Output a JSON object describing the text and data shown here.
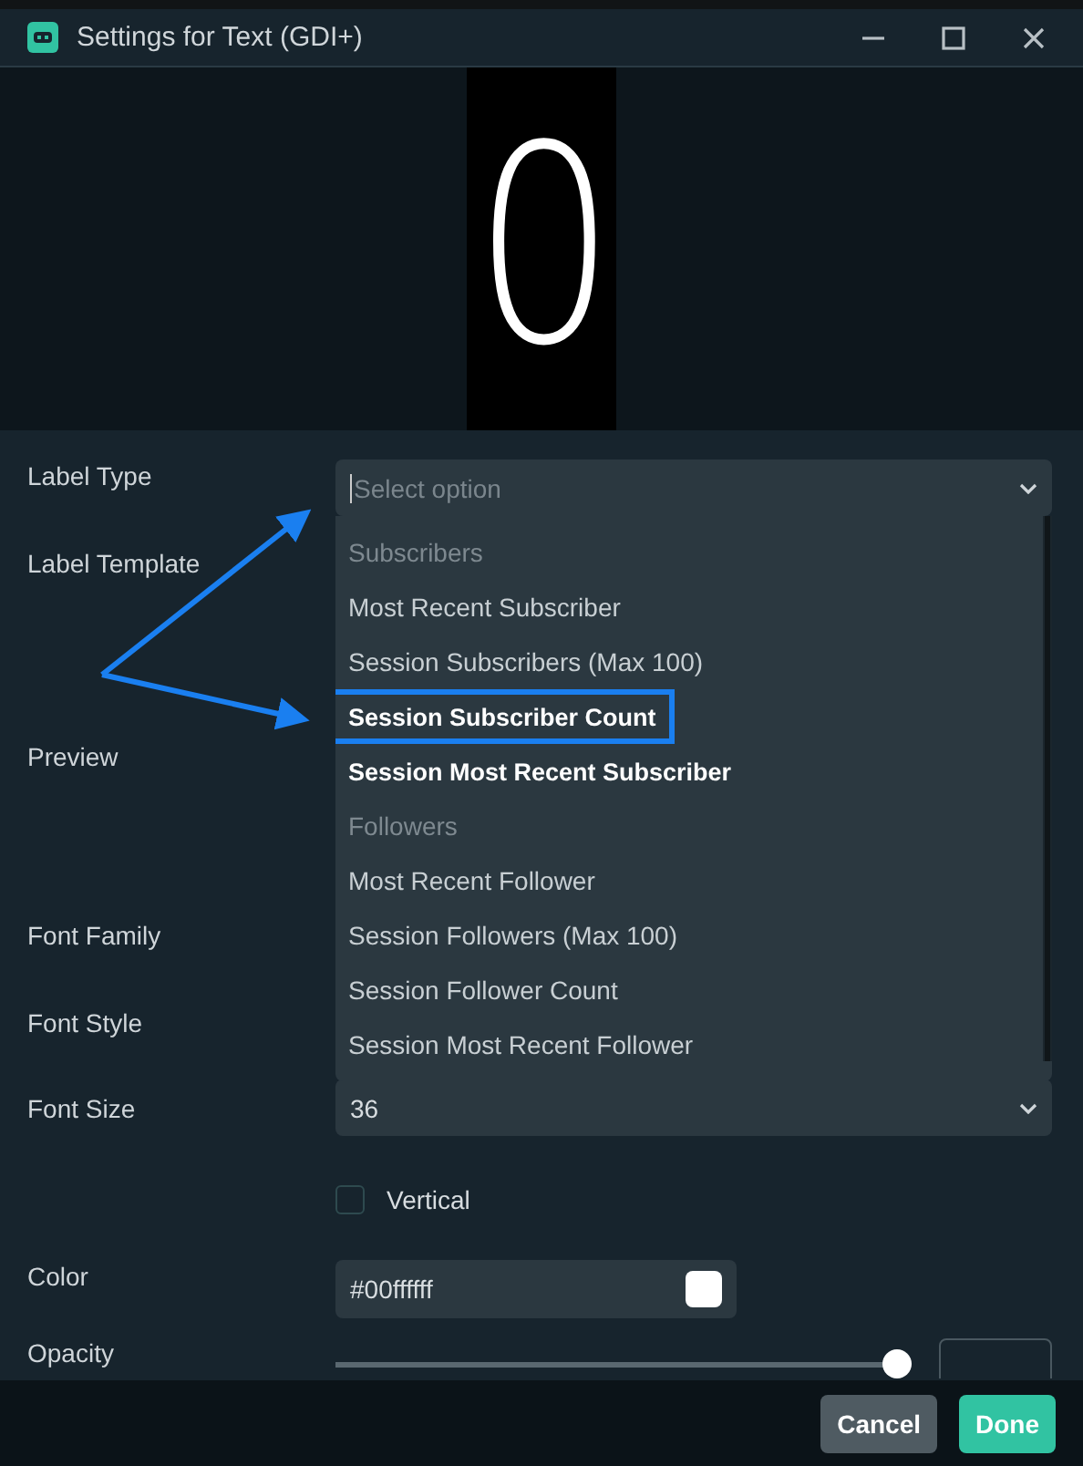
{
  "window": {
    "title": "Settings for Text (GDI+)"
  },
  "preview": {
    "text": "0"
  },
  "form": {
    "label_type": {
      "label": "Label Type",
      "placeholder": "Select option",
      "expanded": true
    },
    "label_template": {
      "label": "Label Template"
    },
    "preview_label": {
      "label": "Preview"
    },
    "font_family": {
      "label": "Font Family"
    },
    "font_style": {
      "label": "Font Style"
    },
    "font_size": {
      "label": "Font Size",
      "value": "36"
    },
    "vertical": {
      "label": "Vertical",
      "checked": false
    },
    "color": {
      "label": "Color",
      "value": "#00ffffff",
      "color": "#ffffff"
    },
    "opacity": {
      "label": "Opacity",
      "level": 1
    }
  },
  "dropdown": {
    "items": [
      {
        "kind": "header",
        "text": "Subscribers",
        "bright": false,
        "outlined": false
      },
      {
        "kind": "option",
        "text": "Most Recent Subscriber",
        "bright": false,
        "outlined": false
      },
      {
        "kind": "option",
        "text": "Session Subscribers (Max 100)",
        "bright": false,
        "outlined": false
      },
      {
        "kind": "option",
        "text": "Session Subscriber Count",
        "bright": true,
        "outlined": true
      },
      {
        "kind": "option",
        "text": "Session Most Recent Subscriber",
        "bright": true,
        "outlined": false
      },
      {
        "kind": "header",
        "text": "Followers",
        "bright": false,
        "outlined": false
      },
      {
        "kind": "option",
        "text": "Most Recent Follower",
        "bright": false,
        "outlined": false
      },
      {
        "kind": "option",
        "text": "Session Followers (Max 100)",
        "bright": false,
        "outlined": false
      },
      {
        "kind": "option",
        "text": "Session Follower Count",
        "bright": false,
        "outlined": false
      },
      {
        "kind": "option",
        "text": "Session Most Recent Follower",
        "bright": false,
        "outlined": false
      }
    ]
  },
  "buttons": [
    {
      "kind": "secondary",
      "label": "Cancel"
    },
    {
      "kind": "primary",
      "label": "Done"
    }
  ]
}
